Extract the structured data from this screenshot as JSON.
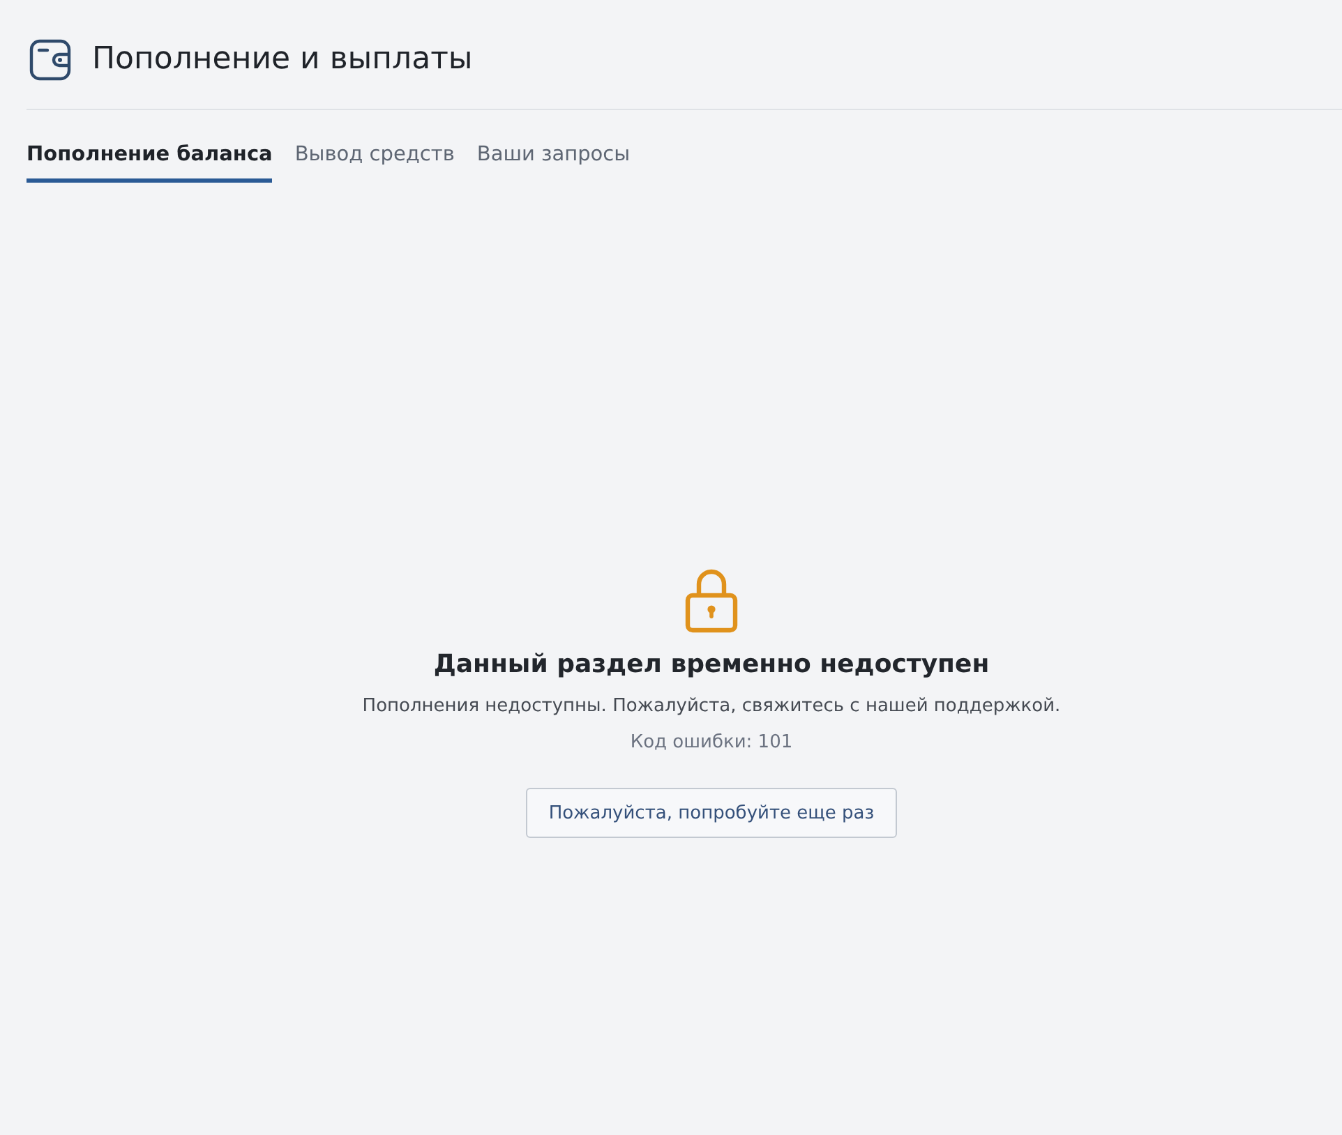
{
  "header": {
    "title": "Пополнение и выплаты"
  },
  "tabs": [
    {
      "label": "Пополнение баланса",
      "selected": true
    },
    {
      "label": "Вывод средств",
      "selected": false
    },
    {
      "label": "Ваши запросы",
      "selected": false
    }
  ],
  "notice": {
    "title": "Данный раздел временно недоступен",
    "message": "Пополнения недоступны. Пожалуйста, свяжитесь с нашей поддержкой.",
    "error_code": "Код ошибки: 101",
    "button": "Пожалуйста, попробуйте еще раз"
  }
}
